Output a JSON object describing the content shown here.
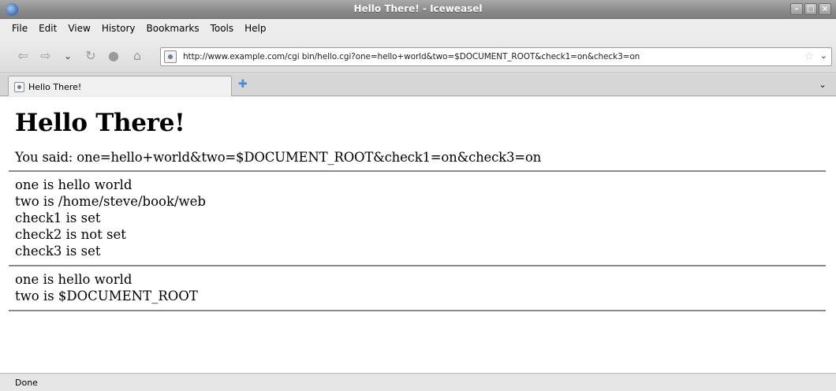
{
  "window": {
    "title": "Hello There! - Iceweasel"
  },
  "menu": [
    "File",
    "Edit",
    "View",
    "History",
    "Bookmarks",
    "Tools",
    "Help"
  ],
  "navigation": {
    "url": "http://www.example.com/cgi bin/hello.cgi?one=hello+world&two=$DOCUMENT_ROOT&check1=on&check3=on"
  },
  "tab": {
    "label": "Hello There!"
  },
  "page": {
    "heading": "Hello There!",
    "said": "You said: one=hello+world&two=$DOCUMENT_ROOT&check1=on&check3=on",
    "block1": [
      "one is hello world",
      "two is /home/steve/book/web",
      "check1 is set",
      "check2 is not set",
      "check3 is set"
    ],
    "block2": [
      "one is hello world",
      "two is $DOCUMENT_ROOT"
    ]
  },
  "status": {
    "text": "Done"
  }
}
